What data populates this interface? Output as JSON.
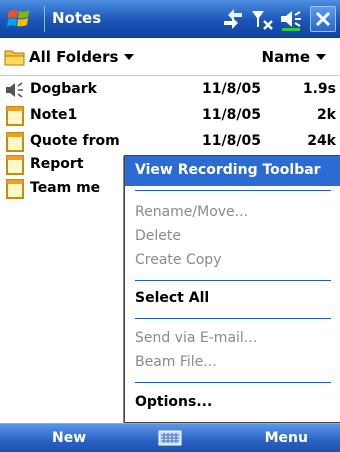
{
  "titlebar": {
    "title": "Notes",
    "icons": [
      "windows-start-icon",
      "connectivity-icon",
      "signal-icon",
      "volume-icon",
      "close-icon"
    ]
  },
  "folderbar": {
    "folder_label": "All Folders",
    "sort_label": "Name"
  },
  "list": {
    "rows": [
      {
        "icon": "recording-icon",
        "name": "Dogbark",
        "date": "11/8/05",
        "size": "1.9s"
      },
      {
        "icon": "note-icon",
        "name": "Note1",
        "date": "11/8/05",
        "size": "2k"
      },
      {
        "icon": "note-icon",
        "name": "Quote from",
        "date": "11/8/05",
        "size": "24k"
      },
      {
        "icon": "note-icon",
        "name": "Report",
        "date": "",
        "size": ""
      },
      {
        "icon": "note-icon",
        "name": "Team me",
        "date": "",
        "size": ""
      }
    ]
  },
  "menu": {
    "highlighted": "View Recording Toolbar",
    "rename": "Rename/Move...",
    "delete": "Delete",
    "copy": "Create Copy",
    "select_all": "Select All",
    "send": "Send via E-mail...",
    "beam": "Beam File...",
    "options": "Options..."
  },
  "bottombar": {
    "left": "New",
    "right": "Menu"
  },
  "colors": {
    "titlebar": "#1a56b8",
    "highlight": "#2c6cd2",
    "disabled_text": "#8a8a8a"
  }
}
